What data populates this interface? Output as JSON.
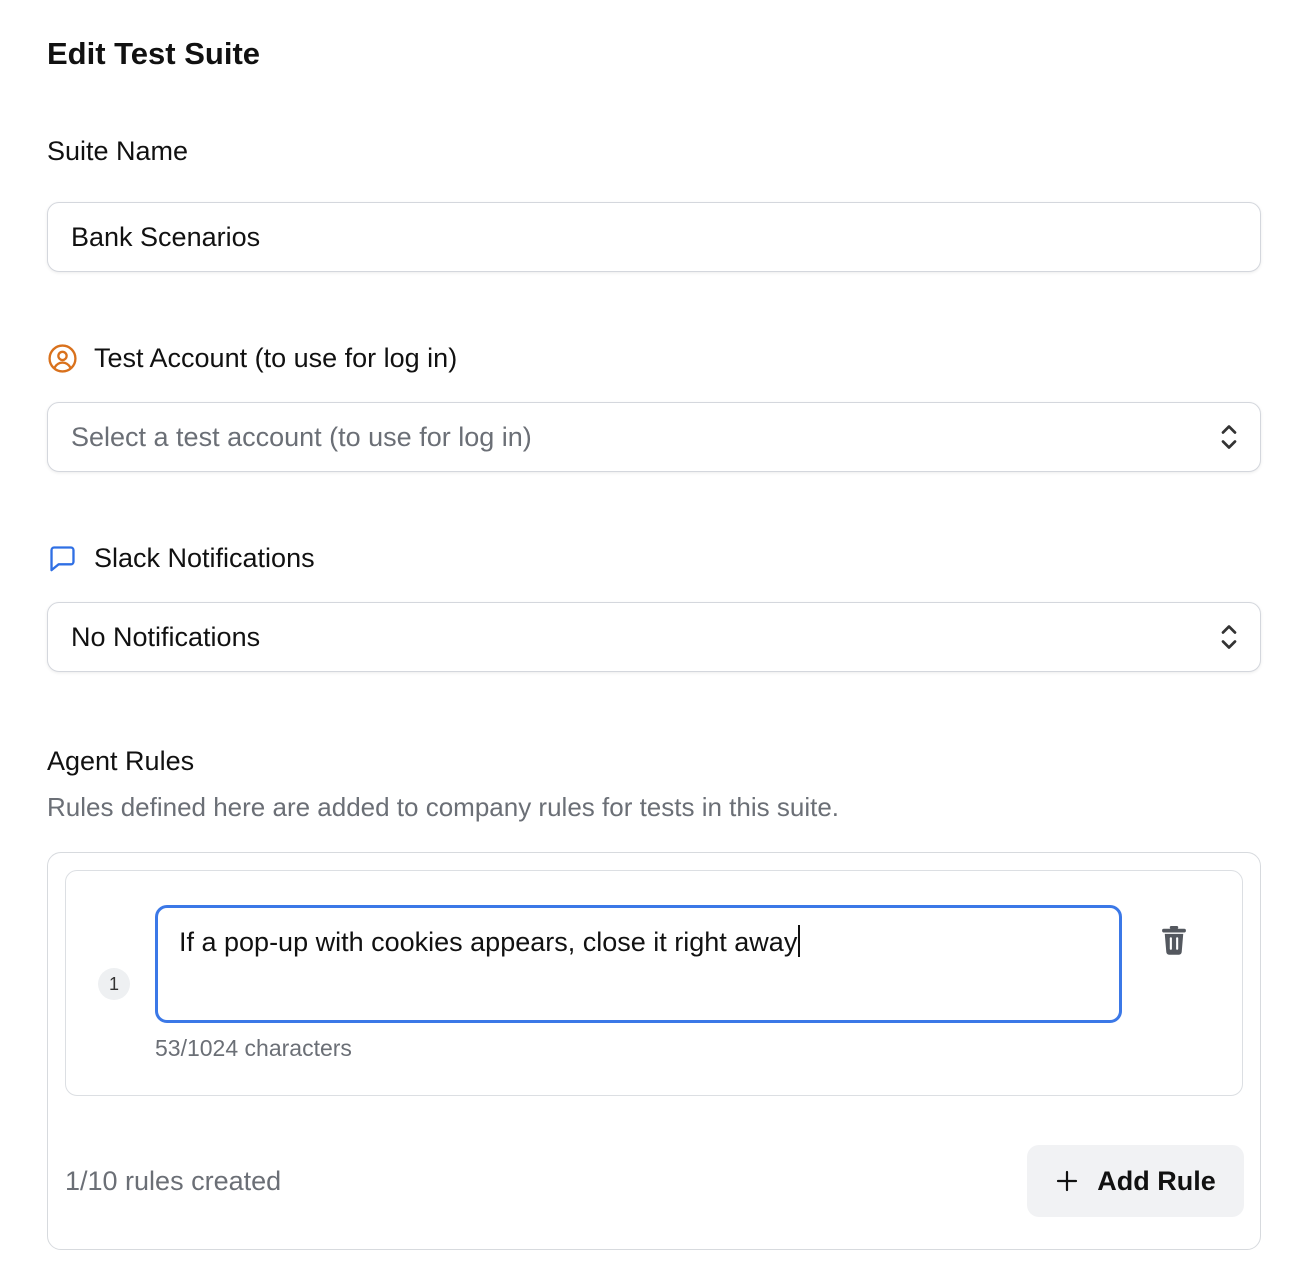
{
  "page": {
    "title": "Edit Test Suite"
  },
  "suite_name": {
    "label": "Suite Name",
    "value": "Bank Scenarios"
  },
  "test_account": {
    "label": "Test Account (to use for log in)",
    "icon": "user-circle-icon",
    "icon_color": "#d9711c",
    "placeholder": "Select a test account (to use for log in)"
  },
  "slack": {
    "label": "Slack Notifications",
    "icon": "chat-bubble-icon",
    "icon_color": "#2f6fe4",
    "selected": "No Notifications"
  },
  "agent_rules": {
    "label": "Agent Rules",
    "description": "Rules defined here are added to company rules for tests in this suite.",
    "rules": [
      {
        "number": "1",
        "text": "If a pop-up with cookies appears, close it right away",
        "char_count": "53/1024 characters"
      }
    ],
    "summary": "1/10 rules created",
    "add_label": "Add Rule",
    "focus_color": "#3b78e7"
  }
}
